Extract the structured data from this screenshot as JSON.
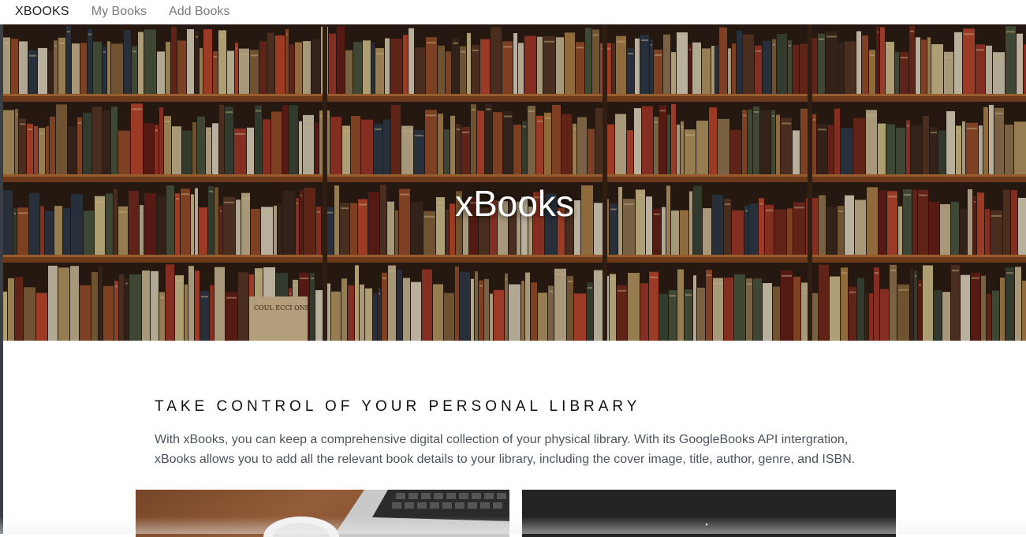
{
  "nav": {
    "brand": "XBOOKS",
    "links": [
      "My Books",
      "Add Books"
    ]
  },
  "hero": {
    "title": "xBooks",
    "book_label": "COUL ECCI ONS"
  },
  "intro": {
    "heading": "TAKE CONTROL OF YOUR PERSONAL LIBRARY",
    "body": "With xBooks, you can keep a comprehensive digital collection of your physical library. With its GoogleBooks API intergration, xBooks allows you to add all the relevant book details to your library, including the cover image, title, author, genre, and ISBN."
  }
}
